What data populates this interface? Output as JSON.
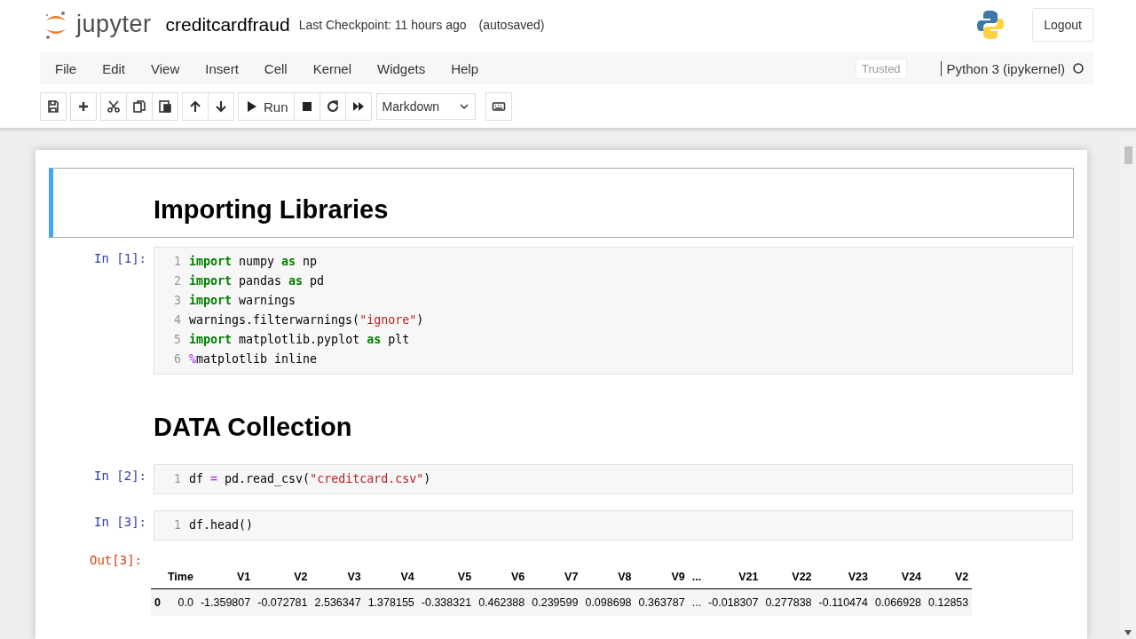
{
  "header": {
    "logo_text": "jupyter",
    "notebook_name": "creditcardfraud",
    "checkpoint": "Last Checkpoint: 11 hours ago",
    "autosave": "(autosaved)",
    "logout": "Logout"
  },
  "menu": {
    "items": [
      "File",
      "Edit",
      "View",
      "Insert",
      "Cell",
      "Kernel",
      "Widgets",
      "Help"
    ],
    "trusted": "Trusted",
    "kernel_name": "Python 3 (ipykernel)"
  },
  "toolbar": {
    "groups": [
      [
        {
          "kind": "save"
        }
      ],
      [
        {
          "kind": "add"
        }
      ],
      [
        {
          "kind": "cut"
        },
        {
          "kind": "copy"
        },
        {
          "kind": "paste"
        }
      ],
      [
        {
          "kind": "up"
        },
        {
          "kind": "down"
        }
      ],
      [
        {
          "kind": "run",
          "label": "Run"
        },
        {
          "kind": "stop"
        },
        {
          "kind": "restart"
        },
        {
          "kind": "fast-forward"
        }
      ]
    ],
    "cell_type": "Markdown",
    "palette": {
      "kind": "keyboard"
    }
  },
  "cells": [
    {
      "kind": "markdown",
      "heading": "Importing Libraries",
      "selected": true
    },
    {
      "kind": "code",
      "prompt": "In [1]:",
      "selected": false,
      "lines": [
        {
          "number": "1",
          "tokens": [
            {
              "text": "import",
              "kind": "kw"
            },
            {
              "text": " numpy ",
              "kind": "plain"
            },
            {
              "text": "as",
              "kind": "kw"
            },
            {
              "text": " np",
              "kind": "plain"
            }
          ]
        },
        {
          "number": "2",
          "tokens": [
            {
              "text": "import",
              "kind": "kw"
            },
            {
              "text": " pandas ",
              "kind": "plain"
            },
            {
              "text": "as",
              "kind": "kw"
            },
            {
              "text": " pd",
              "kind": "plain"
            }
          ]
        },
        {
          "number": "3",
          "tokens": [
            {
              "text": "import",
              "kind": "kw"
            },
            {
              "text": " warnings",
              "kind": "plain"
            }
          ]
        },
        {
          "number": "4",
          "tokens": [
            {
              "text": "warnings.filterwarnings(",
              "kind": "plain"
            },
            {
              "text": "\"ignore\"",
              "kind": "str"
            },
            {
              "text": ")",
              "kind": "plain"
            }
          ]
        },
        {
          "number": "5",
          "tokens": [
            {
              "text": "import",
              "kind": "kw"
            },
            {
              "text": " matplotlib.pyplot ",
              "kind": "plain"
            },
            {
              "text": "as",
              "kind": "kw"
            },
            {
              "text": " plt",
              "kind": "plain"
            }
          ]
        },
        {
          "number": "6",
          "tokens": [
            {
              "text": "%",
              "kind": "op"
            },
            {
              "text": "matplotlib inline",
              "kind": "plain"
            }
          ]
        }
      ]
    },
    {
      "kind": "markdown",
      "heading": "DATA Collection",
      "selected": false
    },
    {
      "kind": "code",
      "prompt": "In [2]:",
      "selected": false,
      "lines": [
        {
          "number": "1",
          "tokens": [
            {
              "text": "df ",
              "kind": "plain"
            },
            {
              "text": "=",
              "kind": "op"
            },
            {
              "text": " pd.read_csv(",
              "kind": "plain"
            },
            {
              "text": "\"creditcard.csv\"",
              "kind": "str"
            },
            {
              "text": ")",
              "kind": "plain"
            }
          ]
        }
      ]
    },
    {
      "kind": "code",
      "prompt": "In [3]:",
      "selected": false,
      "lines": [
        {
          "number": "1",
          "tokens": [
            {
              "text": "df.head()",
              "kind": "plain"
            }
          ]
        }
      ],
      "output": {
        "prompt": "Out[3]:",
        "columns": [
          "Time",
          "V1",
          "V2",
          "V3",
          "V4",
          "V5",
          "V6",
          "V7",
          "V8",
          "V9",
          "...",
          "V21",
          "V22",
          "V23",
          "V24",
          "V2"
        ],
        "rows": [
          {
            "index": "0",
            "cells": [
              "0.0",
              "-1.359807",
              "-0.072781",
              "2.536347",
              "1.378155",
              "-0.338321",
              "0.462388",
              "0.239599",
              "0.098698",
              "0.363787",
              "...",
              "-0.018307",
              "0.277838",
              "-0.110474",
              "0.066928",
              "0.12853"
            ]
          }
        ]
      }
    }
  ]
}
